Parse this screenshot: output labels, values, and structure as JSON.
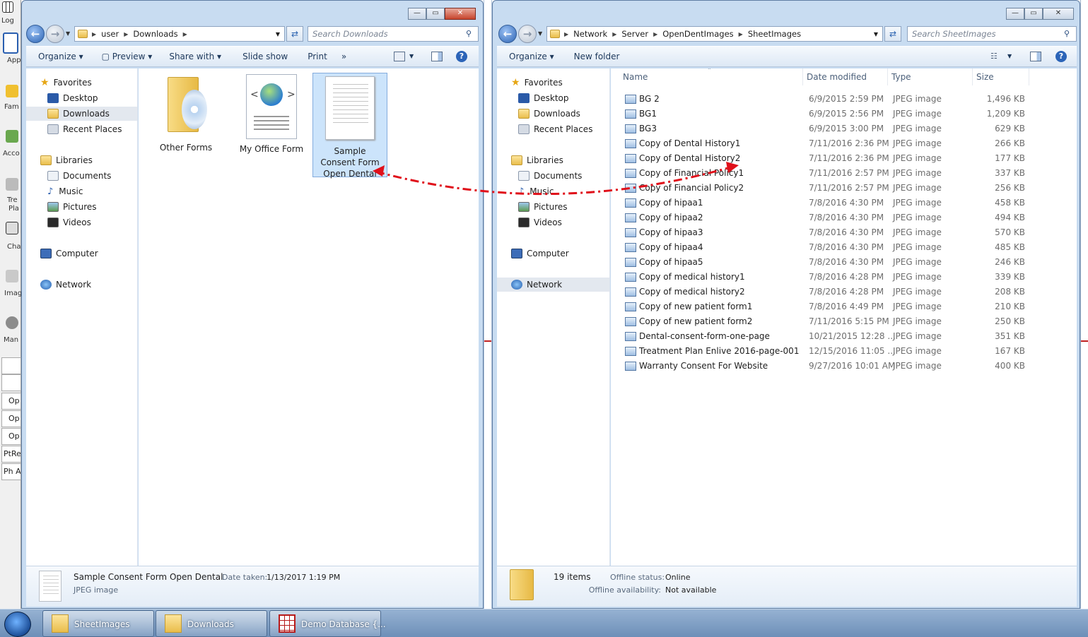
{
  "left_window": {
    "address": [
      "user",
      "Downloads"
    ],
    "search_placeholder": "Search Downloads",
    "toolbar": [
      "Organize",
      "Preview",
      "Share with",
      "Slide show",
      "Print"
    ],
    "more_symbol": "»",
    "nav": {
      "favorites": "Favorites",
      "favorite_items": [
        "Desktop",
        "Downloads",
        "Recent Places"
      ],
      "libraries": "Libraries",
      "library_items": [
        "Documents",
        "Music",
        "Pictures",
        "Videos"
      ],
      "computer": "Computer",
      "network": "Network"
    },
    "files": [
      {
        "label": "Other Forms",
        "kind": "folder"
      },
      {
        "label": "My Office Form",
        "kind": "html"
      },
      {
        "label": "Sample Consent Form Open Dental",
        "kind": "image",
        "selected": true
      }
    ],
    "details": {
      "name": "Sample Consent Form Open Dental",
      "date_label": "Date taken:",
      "date_value": "1/13/2017 1:19 PM",
      "type": "JPEG image"
    }
  },
  "right_window": {
    "address": [
      "Network",
      "Server",
      "OpenDentImages",
      "SheetImages"
    ],
    "search_placeholder": "Search SheetImages",
    "toolbar": [
      "Organize",
      "New folder"
    ],
    "nav": {
      "favorites": "Favorites",
      "favorite_items": [
        "Desktop",
        "Downloads",
        "Recent Places"
      ],
      "libraries": "Libraries",
      "library_items": [
        "Documents",
        "Music",
        "Pictures",
        "Videos"
      ],
      "computer": "Computer",
      "network": "Network"
    },
    "columns": [
      "Name",
      "Date modified",
      "Type",
      "Size"
    ],
    "rows": [
      {
        "name": "BG 2",
        "date": "6/9/2015 2:59 PM",
        "type": "JPEG image",
        "size": "1,496 KB"
      },
      {
        "name": "BG1",
        "date": "6/9/2015 2:56 PM",
        "type": "JPEG image",
        "size": "1,209 KB"
      },
      {
        "name": "BG3",
        "date": "6/9/2015 3:00 PM",
        "type": "JPEG image",
        "size": "629 KB"
      },
      {
        "name": "Copy of Dental History1",
        "date": "7/11/2016 2:36 PM",
        "type": "JPEG image",
        "size": "266 KB"
      },
      {
        "name": "Copy of Dental History2",
        "date": "7/11/2016 2:36 PM",
        "type": "JPEG image",
        "size": "177 KB"
      },
      {
        "name": "Copy of Financial Policy1",
        "date": "7/11/2016 2:57 PM",
        "type": "JPEG image",
        "size": "337 KB"
      },
      {
        "name": "Copy of Financial Policy2",
        "date": "7/11/2016 2:57 PM",
        "type": "JPEG image",
        "size": "256 KB"
      },
      {
        "name": "Copy of hipaa1",
        "date": "7/8/2016 4:30 PM",
        "type": "JPEG image",
        "size": "458 KB"
      },
      {
        "name": "Copy of hipaa2",
        "date": "7/8/2016 4:30 PM",
        "type": "JPEG image",
        "size": "494 KB"
      },
      {
        "name": "Copy of hipaa3",
        "date": "7/8/2016 4:30 PM",
        "type": "JPEG image",
        "size": "570 KB"
      },
      {
        "name": "Copy of hipaa4",
        "date": "7/8/2016 4:30 PM",
        "type": "JPEG image",
        "size": "485 KB"
      },
      {
        "name": "Copy of hipaa5",
        "date": "7/8/2016 4:30 PM",
        "type": "JPEG image",
        "size": "246 KB"
      },
      {
        "name": "Copy of medical history1",
        "date": "7/8/2016 4:28 PM",
        "type": "JPEG image",
        "size": "339 KB"
      },
      {
        "name": "Copy of medical history2",
        "date": "7/8/2016 4:28 PM",
        "type": "JPEG image",
        "size": "208 KB"
      },
      {
        "name": "Copy of new patient form1",
        "date": "7/8/2016 4:49 PM",
        "type": "JPEG image",
        "size": "210 KB"
      },
      {
        "name": "Copy of new patient form2",
        "date": "7/11/2016 5:15 PM",
        "type": "JPEG image",
        "size": "250 KB"
      },
      {
        "name": "Dental-consent-form-one-page",
        "date": "10/21/2015 12:28 ...",
        "type": "JPEG image",
        "size": "351 KB"
      },
      {
        "name": "Treatment Plan Enlive 2016-page-001",
        "date": "12/15/2016 11:05 ...",
        "type": "JPEG image",
        "size": "167 KB"
      },
      {
        "name": "Warranty Consent For Website",
        "date": "9/27/2016 10:01 AM",
        "type": "JPEG image",
        "size": "400 KB"
      }
    ],
    "details": {
      "count": "19 items",
      "offline_status_label": "Offline status:",
      "offline_status_value": "Online",
      "offline_avail_label": "Offline availability:",
      "offline_avail_value": "Not available"
    }
  },
  "app_strip": {
    "labels": [
      "Log",
      "App",
      "Fam",
      "Acco",
      "Tre",
      "Pla",
      "Cha",
      "Imag",
      "Man"
    ],
    "cells": [
      "Op",
      "Op",
      "Op",
      "PtRe",
      "Ph A"
    ]
  },
  "taskbar": {
    "items": [
      "SheetImages",
      "Downloads",
      "Demo Database {..."
    ]
  },
  "colors": {
    "arrow": "#e0101a",
    "selection": "#cce4fb",
    "window_frame": "#c8dcf1"
  },
  "icons": [
    "back-icon",
    "forward-icon",
    "folder-icon",
    "refresh-icon",
    "search-icon",
    "star-icon",
    "desktop-icon",
    "library-icon",
    "music-icon",
    "computer-icon",
    "network-icon",
    "jpeg-icon",
    "help-icon",
    "views-icon",
    "preview-pane-icon",
    "windows-orb-icon"
  ]
}
